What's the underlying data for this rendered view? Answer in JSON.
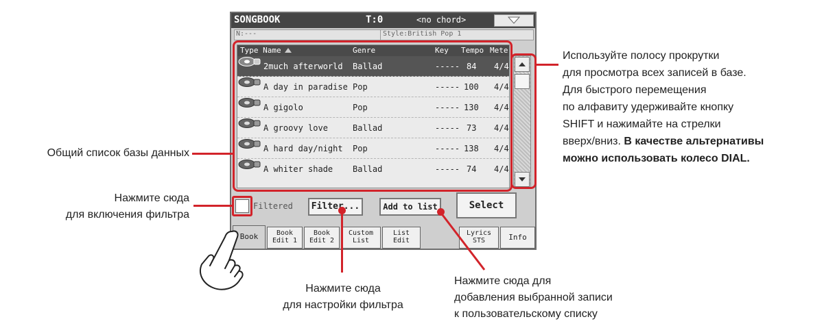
{
  "header": {
    "title": "SONGBOOK",
    "transpose": "T:0",
    "chord": "<no chord>"
  },
  "info": {
    "name": "N:---",
    "style": "Style:British Pop 1"
  },
  "columns": {
    "type_name": "Type Name",
    "genre": "Genre",
    "key": "Key",
    "tempo": "Tempo",
    "meter": "Mete"
  },
  "rows": [
    {
      "name": "2much afterworld",
      "genre": "Ballad",
      "key": "-----",
      "tempo": "84",
      "meter": "4/4"
    },
    {
      "name": "A day in paradise",
      "genre": "Pop",
      "key": "-----",
      "tempo": "100",
      "meter": "4/4"
    },
    {
      "name": "A gigolo",
      "genre": "Pop",
      "key": "-----",
      "tempo": "130",
      "meter": "4/4"
    },
    {
      "name": "A groovy love",
      "genre": "Ballad",
      "key": "-----",
      "tempo": "73",
      "meter": "4/4"
    },
    {
      "name": "A hard day/night",
      "genre": "Pop",
      "key": "-----",
      "tempo": "138",
      "meter": "4/4"
    },
    {
      "name": "A whiter shade",
      "genre": "Ballad",
      "key": "-----",
      "tempo": "74",
      "meter": "4/4"
    }
  ],
  "controls": {
    "filtered_label": "Filtered",
    "filter_btn": "Filter...",
    "add_btn": "Add to list",
    "select_btn": "Select"
  },
  "tabs": [
    {
      "label": "Book"
    },
    {
      "line1": "Book",
      "line2": "Edit 1"
    },
    {
      "line1": "Book",
      "line2": "Edit 2"
    },
    {
      "line1": "Custom",
      "line2": "List"
    },
    {
      "line1": "List",
      "line2": "Edit"
    },
    {
      "line1": "Lyrics",
      "line2": "STS"
    },
    {
      "label": "Info"
    }
  ],
  "annotations": {
    "list": "Общий список базы данных",
    "filter_on_1": "Нажмите сюда",
    "filter_on_2": "для включения фильтра",
    "filter_setup_1": "Нажмите сюда",
    "filter_setup_2": "для настройки фильтра",
    "add_1": "Нажмите сюда для",
    "add_2": "добавления выбранной записи",
    "add_3": "к пользовательскому списку",
    "scroll_1": "Используйте полосу прокрутки",
    "scroll_2": "для просмотра всех записей в базе.",
    "scroll_3": "Для быстрого перемещения",
    "scroll_4": "по алфавиту удерживайте кнопку",
    "scroll_5": "SHIFT и нажимайте на стрелки",
    "scroll_6a": "вверх/вниз.",
    "scroll_6b": "В качестве альтернативы",
    "scroll_7": "можно использовать колесо DIAL."
  },
  "colors": {
    "accent": "#d2232a",
    "titlebar": "#454545",
    "selected_row": "#555555"
  }
}
